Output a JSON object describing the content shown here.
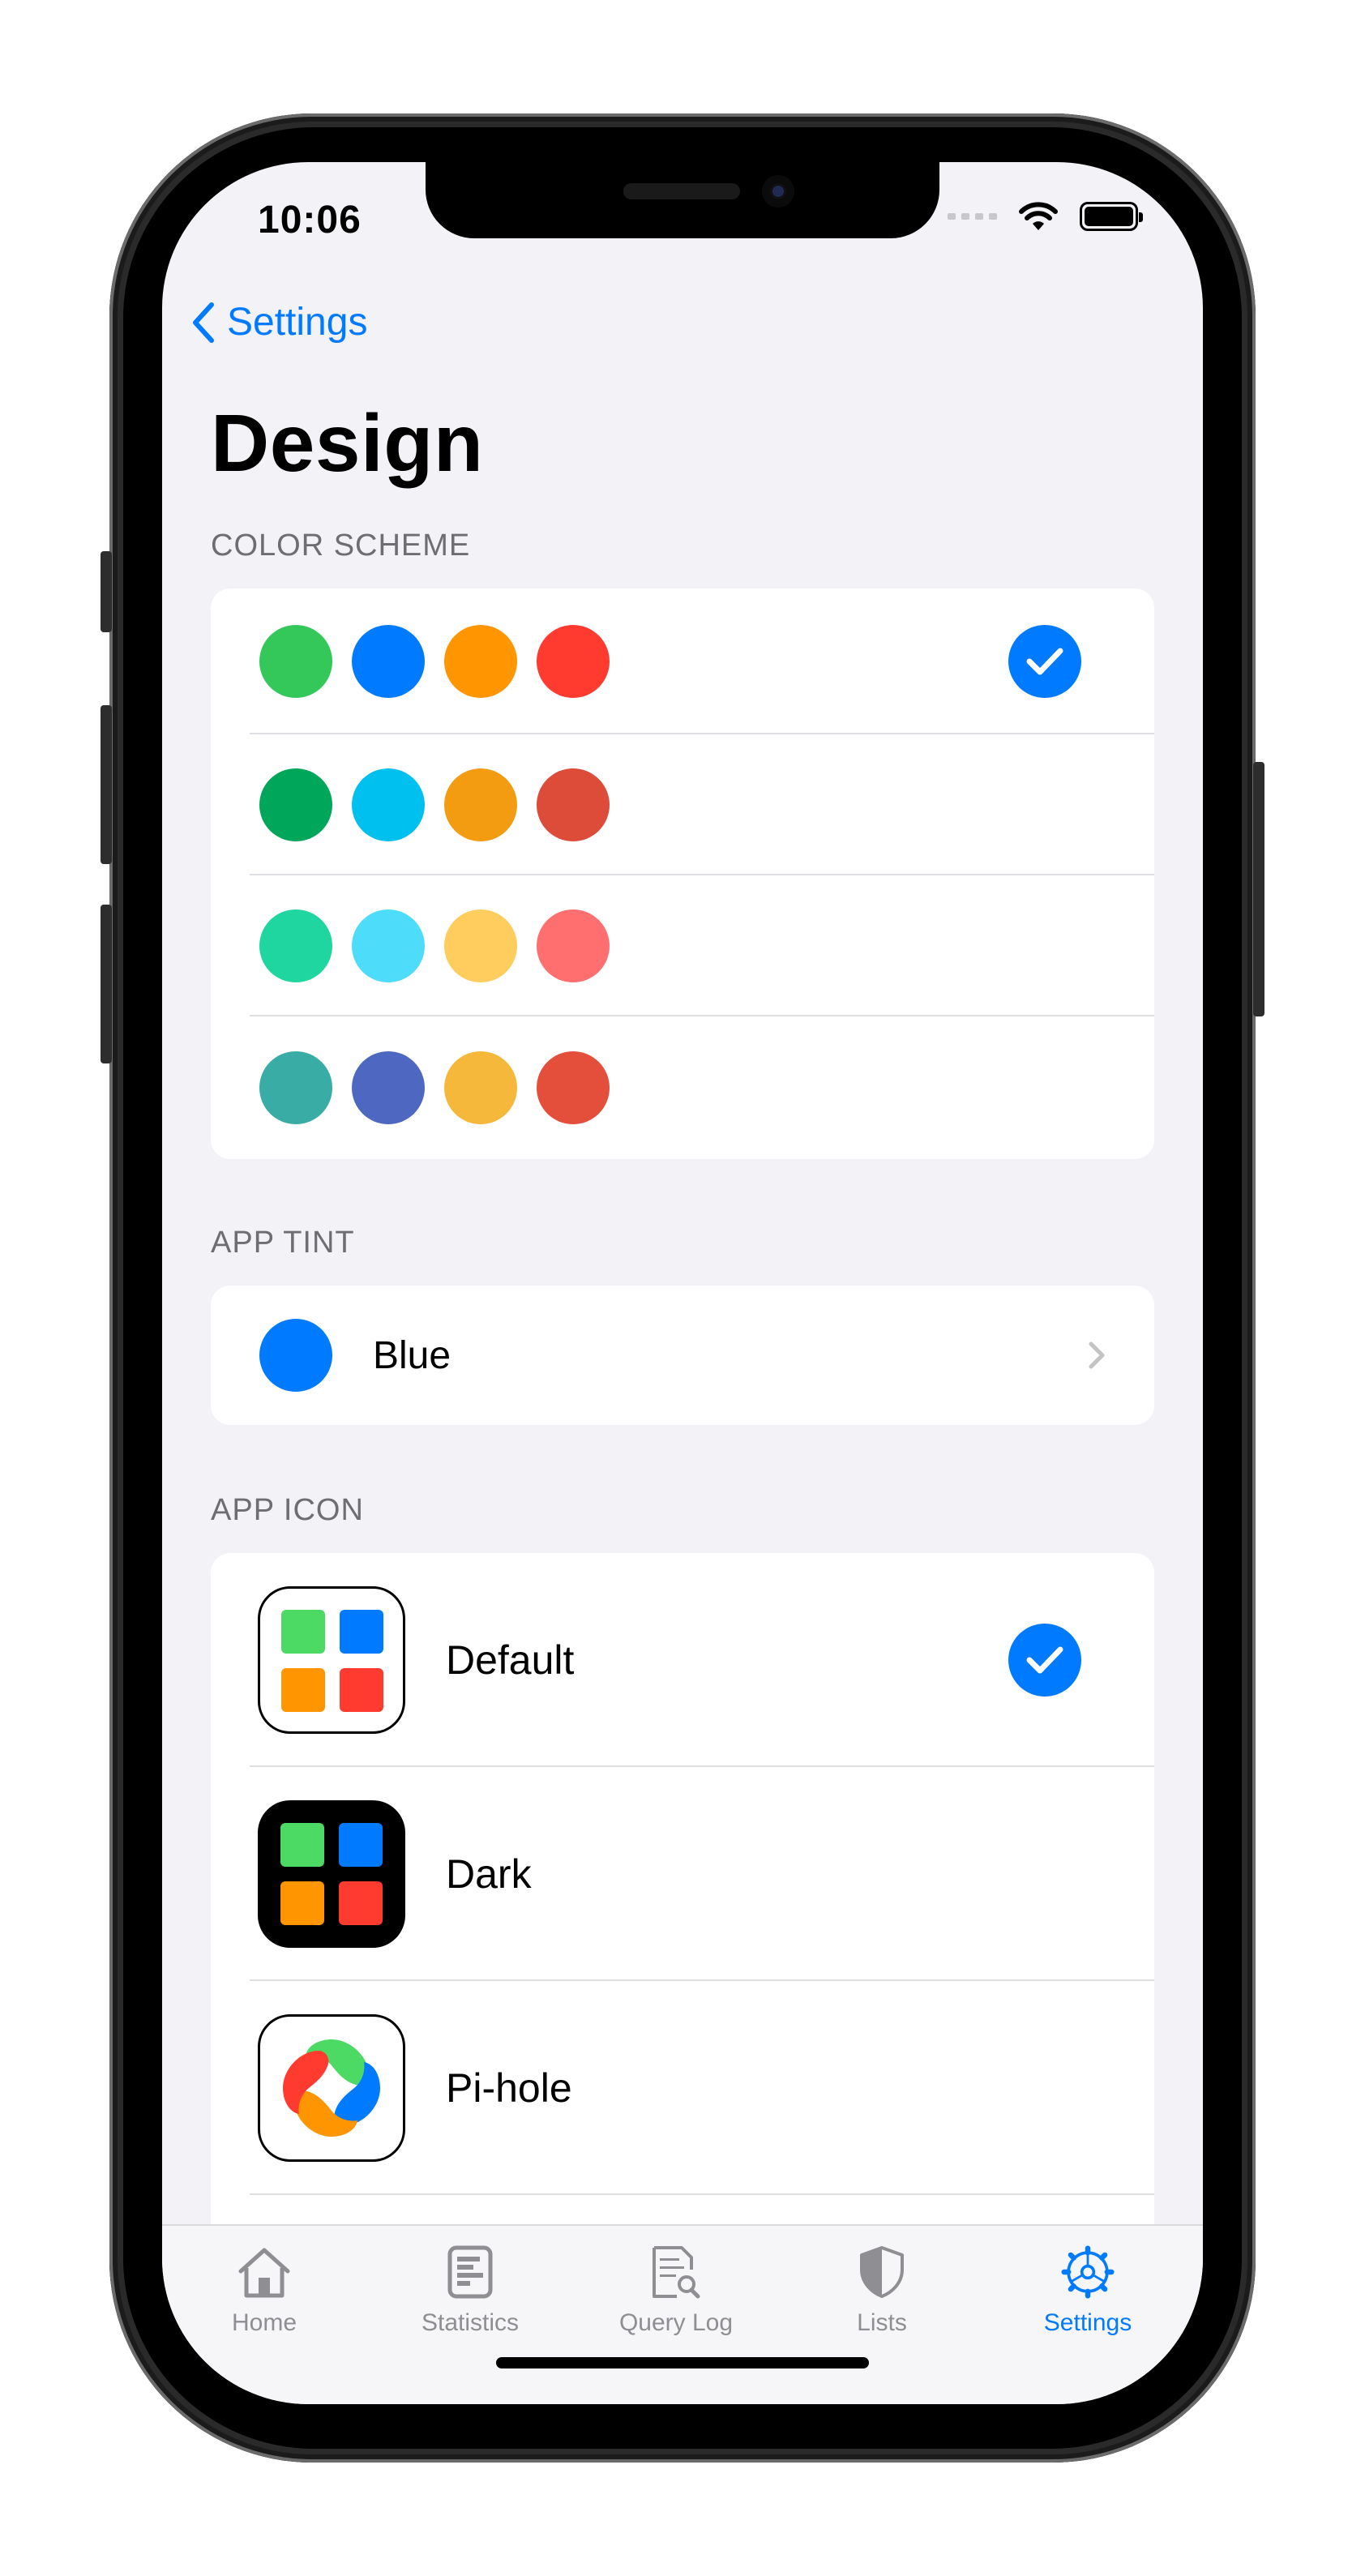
{
  "status_bar": {
    "time": "10:06",
    "icons": [
      "signal-dots-icon",
      "wifi-icon",
      "battery-icon"
    ]
  },
  "nav": {
    "back_label": "Settings",
    "back_icon": "chevron-left-icon"
  },
  "page": {
    "title": "Design"
  },
  "color_scheme": {
    "header": "COLOR SCHEME",
    "rows": [
      {
        "colors": [
          "#34c759",
          "#007aff",
          "#ff9500",
          "#ff3b30"
        ],
        "selected": true
      },
      {
        "colors": [
          "#00a65a",
          "#00c0ef",
          "#f39c12",
          "#dd4b39"
        ],
        "selected": false
      },
      {
        "colors": [
          "#20d6a0",
          "#4ddcfa",
          "#ffcd5d",
          "#ff6f6f"
        ],
        "selected": false
      },
      {
        "colors": [
          "#3aaca6",
          "#4e67c0",
          "#f5b83b",
          "#e34f3a"
        ],
        "selected": false
      }
    ]
  },
  "app_tint": {
    "header": "APP TINT",
    "value": "Blue",
    "color": "#007aff"
  },
  "app_icon": {
    "header": "APP ICON",
    "items": [
      {
        "label": "Default",
        "style": "light",
        "selected": true
      },
      {
        "label": "Dark",
        "style": "dark",
        "selected": false
      },
      {
        "label": "Pi-hole",
        "style": "pihole",
        "selected": false
      }
    ]
  },
  "tab_bar": {
    "tabs": [
      {
        "label": "Home",
        "icon": "house-icon",
        "active": false
      },
      {
        "label": "Statistics",
        "icon": "statistics-icon",
        "active": false
      },
      {
        "label": "Query Log",
        "icon": "query-log-icon",
        "active": false
      },
      {
        "label": "Lists",
        "icon": "shield-icon",
        "active": false
      },
      {
        "label": "Settings",
        "icon": "gear-icon",
        "active": true
      }
    ]
  },
  "colors": {
    "accent": "#007aff",
    "background": "#f2f2f7",
    "inactive": "#8e8e93"
  }
}
